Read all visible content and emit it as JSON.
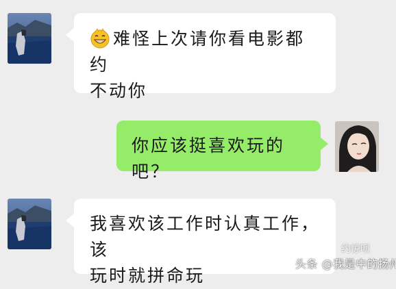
{
  "messages": [
    {
      "sender": "other",
      "text": "难怪上次请你看电影都约不动你",
      "line1": "难怪上次请你看电影都约",
      "line2": "不动你",
      "has_emoji": true
    },
    {
      "sender": "self",
      "text": "你应该挺喜欢玩的吧？"
    },
    {
      "sender": "other",
      "text": "我喜欢该工作时认真工作，该玩时就拼命玩",
      "line1": "我喜欢该工作时认真工作，该",
      "line2": "玩时就拼命玩"
    }
  ],
  "watermark": {
    "text": "头条 @我是中的扬州",
    "overlay": "约惊呗"
  },
  "colors": {
    "background": "#ededed",
    "bubble_other": "#ffffff",
    "bubble_self": "#95ec69"
  }
}
